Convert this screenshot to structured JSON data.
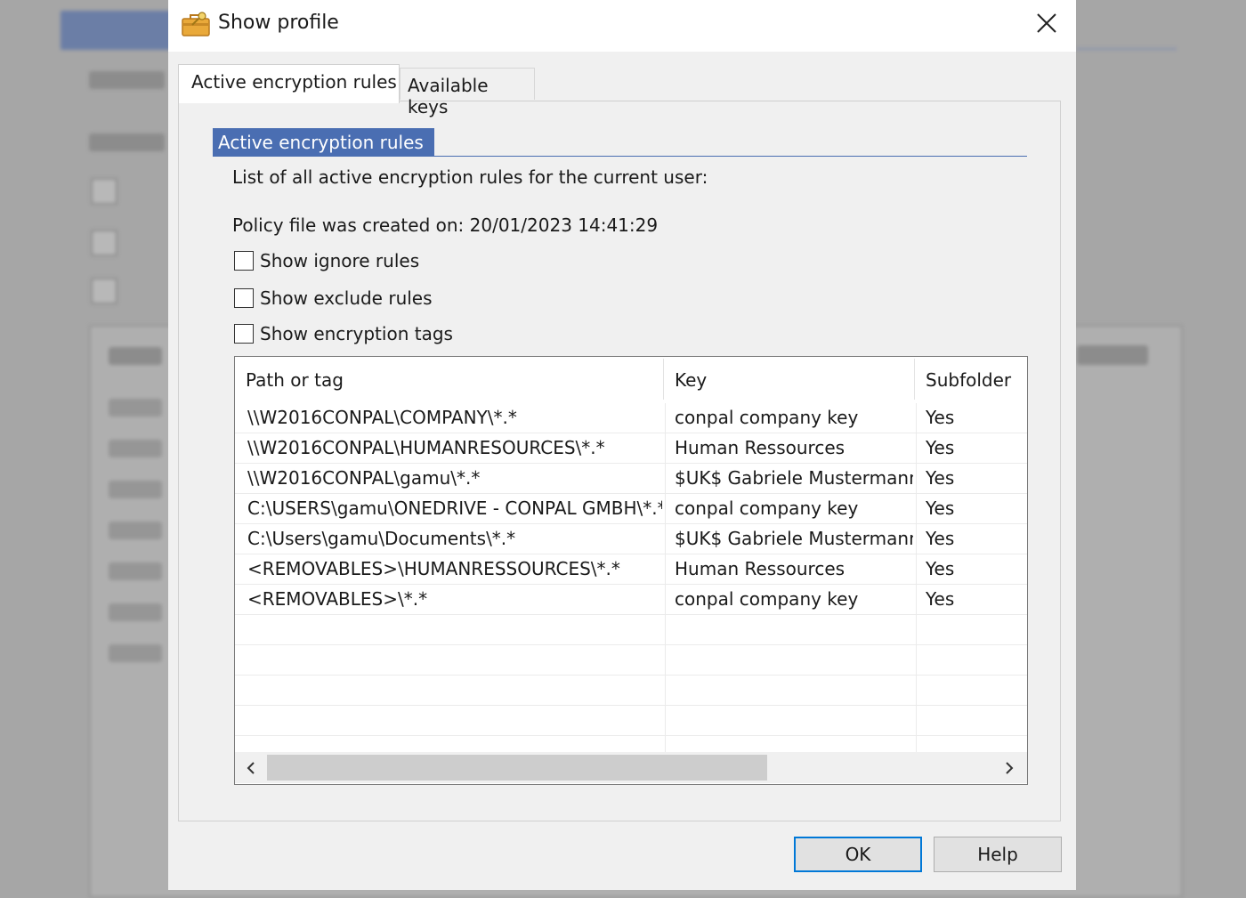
{
  "dialog": {
    "title": "Show profile",
    "icons": {
      "title": "briefcase-key-icon",
      "close": "close-icon"
    }
  },
  "tabs": [
    {
      "label": "Active encryption rules",
      "active": true
    },
    {
      "label": "Available keys",
      "active": false
    }
  ],
  "group": {
    "header": "Active encryption rules",
    "description": "List of all active encryption rules for the current user:",
    "policy_created": "Policy file was created on: 20/01/2023  14:41:29"
  },
  "checkboxes": [
    {
      "label": "Show ignore rules",
      "checked": false
    },
    {
      "label": "Show exclude rules",
      "checked": false
    },
    {
      "label": "Show encryption tags",
      "checked": false
    }
  ],
  "table": {
    "columns": [
      "Path or tag",
      "Key",
      "Subfolder"
    ],
    "rows": [
      {
        "path": "\\\\W2016CONPAL\\COMPANY\\*.*",
        "key": "conpal company key",
        "subfolder": "Yes"
      },
      {
        "path": "\\\\W2016CONPAL\\HUMANRESOURCES\\*.*",
        "key": "Human Ressources",
        "subfolder": "Yes"
      },
      {
        "path": "\\\\W2016CONPAL\\gamu\\*.*",
        "key": "$UK$ Gabriele Mustermann",
        "subfolder": "Yes"
      },
      {
        "path": "C:\\USERS\\gamu\\ONEDRIVE - CONPAL GMBH\\*.*",
        "key": "conpal company key",
        "subfolder": "Yes"
      },
      {
        "path": "C:\\Users\\gamu\\Documents\\*.*",
        "key": "$UK$ Gabriele Mustermann",
        "subfolder": "Yes"
      },
      {
        "path": "<REMOVABLES>\\HUMANRESSOURCES\\*.*",
        "key": "Human Ressources",
        "subfolder": "Yes"
      },
      {
        "path": "<REMOVABLES>\\*.*",
        "key": "conpal company key",
        "subfolder": "Yes"
      }
    ],
    "scroll_icons": {
      "left": "chevron-left-icon",
      "right": "chevron-right-icon"
    }
  },
  "buttons": {
    "ok": "OK",
    "help": "Help"
  },
  "colors": {
    "accent": "#4a6eb2",
    "focus_border": "#0078d7",
    "dialog_bg": "#f0f0f0"
  }
}
